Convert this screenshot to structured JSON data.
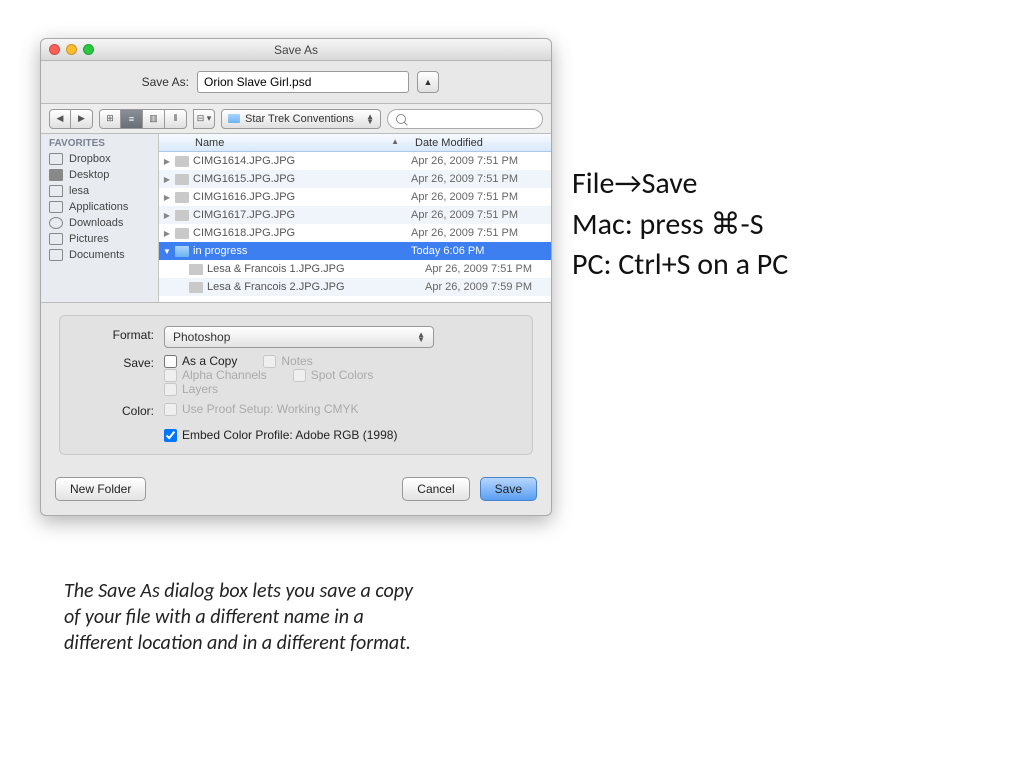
{
  "dialog": {
    "title": "Save As",
    "saveas_label": "Save As:",
    "filename": "Orion Slave Girl.psd",
    "location": "Star Trek Conventions",
    "search_placeholder": ""
  },
  "sidebar": {
    "heading": "FAVORITES",
    "items": [
      "Dropbox",
      "Desktop",
      "lesa",
      "Applications",
      "Downloads",
      "Pictures",
      "Documents"
    ]
  },
  "columns": {
    "name": "Name",
    "date": "Date Modified"
  },
  "files": [
    {
      "name": "CIMG1614.JPG.JPG",
      "date": "Apr 26, 2009 7:51 PM",
      "folder": false,
      "sel": false,
      "indent": 0
    },
    {
      "name": "CIMG1615.JPG.JPG",
      "date": "Apr 26, 2009 7:51 PM",
      "folder": false,
      "sel": false,
      "indent": 0
    },
    {
      "name": "CIMG1616.JPG.JPG",
      "date": "Apr 26, 2009 7:51 PM",
      "folder": false,
      "sel": false,
      "indent": 0
    },
    {
      "name": "CIMG1617.JPG.JPG",
      "date": "Apr 26, 2009 7:51 PM",
      "folder": false,
      "sel": false,
      "indent": 0
    },
    {
      "name": "CIMG1618.JPG.JPG",
      "date": "Apr 26, 2009 7:51 PM",
      "folder": false,
      "sel": false,
      "indent": 0
    },
    {
      "name": "in progress",
      "date": "Today 6:06 PM",
      "folder": true,
      "sel": true,
      "indent": 0
    },
    {
      "name": "Lesa & Francois 1.JPG.JPG",
      "date": "Apr 26, 2009 7:51 PM",
      "folder": false,
      "sel": false,
      "indent": 1
    },
    {
      "name": "Lesa & Francois 2.JPG.JPG",
      "date": "Apr 26, 2009 7:59 PM",
      "folder": false,
      "sel": false,
      "indent": 1
    }
  ],
  "options": {
    "format_label": "Format:",
    "format_value": "Photoshop",
    "save_label": "Save:",
    "as_copy": "As a Copy",
    "notes": "Notes",
    "alpha": "Alpha Channels",
    "spot": "Spot Colors",
    "layers": "Layers",
    "color_label": "Color:",
    "proof": "Use Proof Setup:  Working CMYK",
    "embed": "Embed Color Profile:  Adobe RGB (1998)"
  },
  "buttons": {
    "newfolder": "New Folder",
    "cancel": "Cancel",
    "save": "Save"
  },
  "right": {
    "l1": "File→Save",
    "l2": "Mac: press ⌘-S",
    "l3": "PC: Ctrl+S on a PC"
  },
  "caption": "The Save As dialog box lets you save a copy of your file with a different name in a different location and in a different format."
}
